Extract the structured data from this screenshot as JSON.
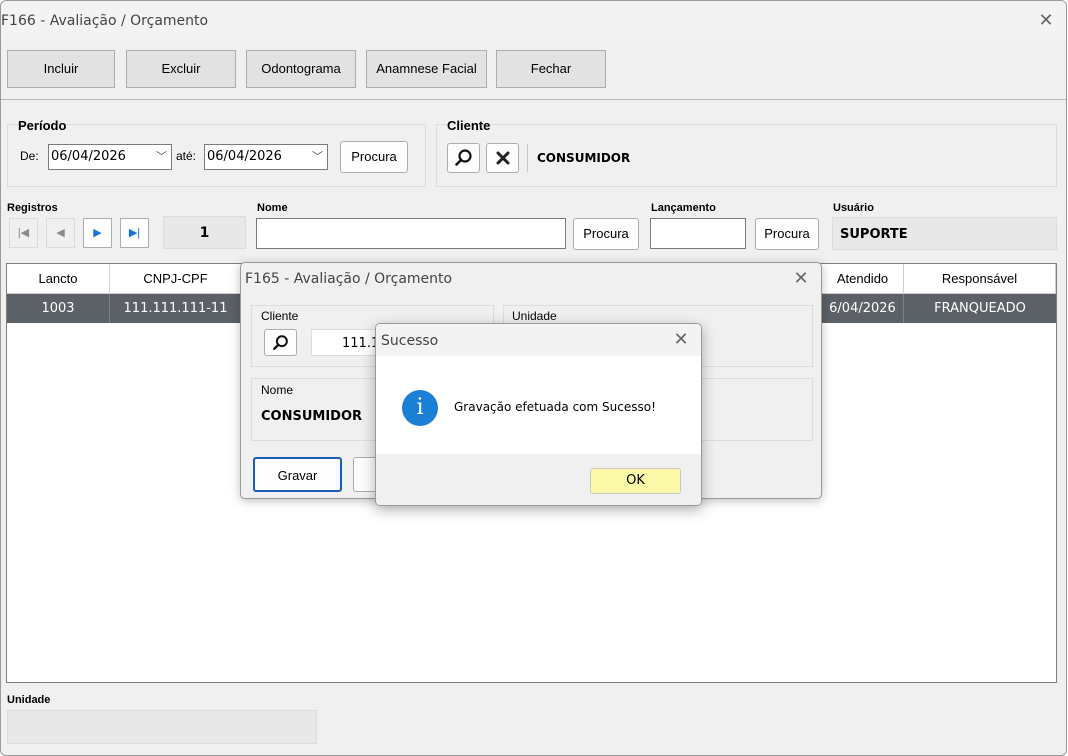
{
  "main_window": {
    "title": "F166 - Avaliação / Orçamento",
    "close_glyph": "✕",
    "toolbar": [
      "Incluir",
      "Excluir",
      "Odontograma",
      "Anamnese Facial",
      "Fechar"
    ]
  },
  "periodo": {
    "heading": "Período",
    "from_label": "De:",
    "from_value": "06/04/2026",
    "to_label": "até:",
    "to_value": "06/04/2026",
    "search_label": "Procura"
  },
  "cliente": {
    "heading": "Cliente",
    "name": "CONSUMIDOR"
  },
  "registros": {
    "label": "Registros",
    "count": "1"
  },
  "nome": {
    "label": "Nome",
    "value": "",
    "search_label": "Procura"
  },
  "lancamento": {
    "label": "Lançamento",
    "value": "",
    "search_label": "Procura"
  },
  "usuario": {
    "label": "Usuário",
    "value": "SUPORTE"
  },
  "grid": {
    "headers": [
      "Lancto",
      "CNPJ-CPF",
      "Atendido",
      "Responsável"
    ],
    "rows": [
      {
        "lancto": "1003",
        "cnpj": "111.111.111-11",
        "atendido": "6/04/2026",
        "responsavel": "FRANQUEADO"
      }
    ]
  },
  "unidade": {
    "label": "Unidade",
    "value": ""
  },
  "dialog_f165": {
    "title": "F165 - Avaliação / Orçamento",
    "close_glyph": "✕",
    "cliente_label": "Cliente",
    "cliente_value": "111.1",
    "unidade_label": "Unidade",
    "nome_label": "Nome",
    "nome_value": "CONSUMIDOR",
    "save_label": "Gravar"
  },
  "dialog_sucesso": {
    "title": "Sucesso",
    "close_glyph": "✕",
    "message": "Gravação efetuada com Sucesso!",
    "ok_label": "OK",
    "info_glyph": "i",
    "colors": {
      "info": "#1c7fd6",
      "ok_highlight": "#fbf8a8"
    }
  }
}
